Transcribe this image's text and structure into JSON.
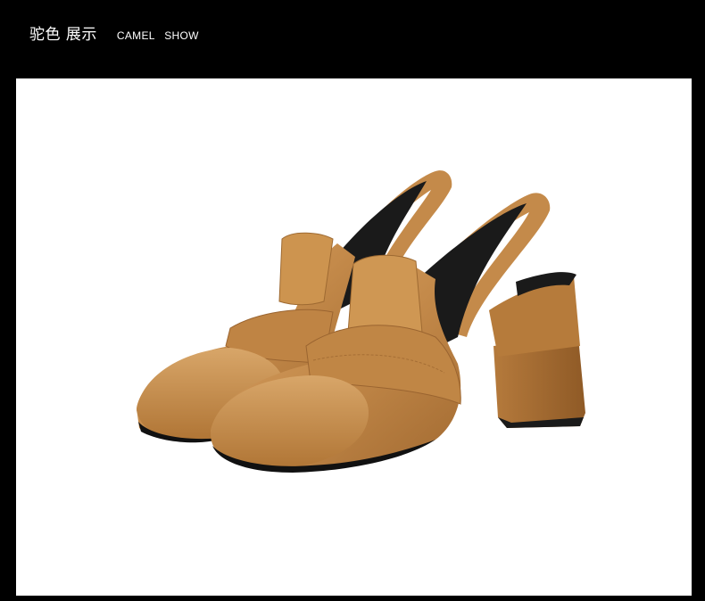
{
  "header": {
    "title_cn": "驼色 展示",
    "title_en": "CAMEL   SHOW"
  },
  "photo": {
    "subject": "pair-of-camel-slingback-block-heel-loafers",
    "colors": {
      "leather": "#C48A4A",
      "leather_shadow": "#A26A31",
      "leather_highlight": "#D9A56A",
      "lining": "#1A1A1A",
      "background": "#FFFFFF",
      "page": "#000000"
    }
  }
}
